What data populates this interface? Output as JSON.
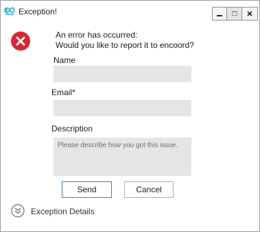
{
  "window": {
    "title": "Exception!",
    "icons": {
      "app": "infinity-logo-icon",
      "minimize": "minimize-icon",
      "maximize": "maximize-icon",
      "close": "close-icon"
    }
  },
  "message": {
    "icon": "error-icon",
    "line1": "An error has occurred:",
    "line2": "Would you like to report it to encoord?"
  },
  "form": {
    "name_label": "Name",
    "name_value": "",
    "email_label": "Email*",
    "email_value": "",
    "description_label": "Description",
    "description_placeholder": "Please describe how you got this issue."
  },
  "buttons": {
    "send": "Send",
    "cancel": "Cancel"
  },
  "details": {
    "label": "Exception Details",
    "icon": "chevron-down-circle-icon"
  },
  "colors": {
    "error_red": "#e0242f",
    "field_bg": "#e5e5e5",
    "default_button_border": "#2d7fd1",
    "logo_blue": "#29a3e0"
  }
}
